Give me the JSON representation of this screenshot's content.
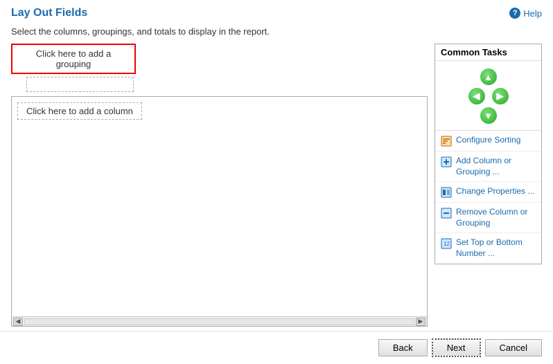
{
  "header": {
    "title": "Lay Out Fields",
    "help_label": "Help"
  },
  "subtitle": "Select the columns, groupings, and totals to display in the report.",
  "left_panel": {
    "add_grouping_btn": "Click here to add a grouping",
    "add_column_btn": "Click here to add a column"
  },
  "right_panel": {
    "common_tasks_title": "Common Tasks",
    "tasks": [
      {
        "id": "configure-sorting",
        "label": "Configure Sorting",
        "icon": "sort-icon"
      },
      {
        "id": "add-column",
        "label": "Add Column or\nGrouping ...",
        "icon": "add-icon"
      },
      {
        "id": "change-properties",
        "label": "Change Properties ...",
        "icon": "change-icon"
      },
      {
        "id": "remove-column",
        "label": "Remove Column or\nGrouping",
        "icon": "remove-icon"
      },
      {
        "id": "set-top-bottom",
        "label": "Set Top or Bottom\nNumber ...",
        "icon": "set-icon"
      }
    ]
  },
  "footer": {
    "back_label": "Back",
    "next_label": "Next",
    "cancel_label": "Cancel"
  }
}
